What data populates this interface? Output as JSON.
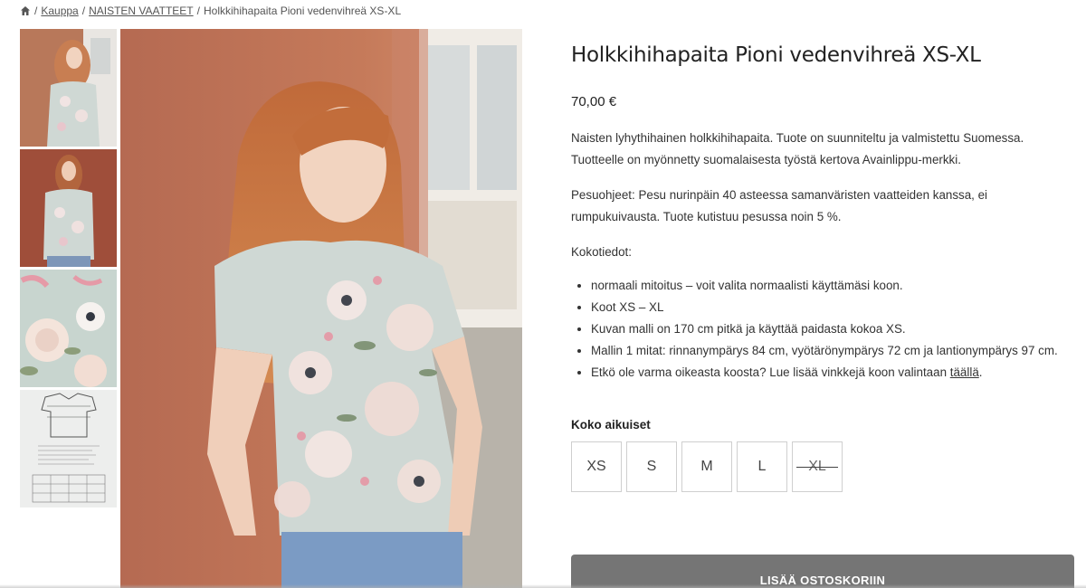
{
  "breadcrumb": {
    "icon": "home-icon",
    "items": [
      "Kauppa",
      "NAISTEN VAATTEET",
      "Holkkihihapaita Pioni vedenvihreä XS-XL"
    ]
  },
  "gallery": {
    "thumbnails": [
      {
        "alt": "Holkkihihapaita Pioni vedenvihreä XS-XL"
      },
      {
        "alt": "Holkkihihapaita Pioni vedenvihreä XS-XL"
      },
      {
        "alt": "Pioni kuosi"
      },
      {
        "alt": "Kokotaulukko"
      }
    ],
    "main_alt": "Holkkihihapaita Pioni vedenvihreä XS-XL"
  },
  "product": {
    "title": "Holkkihihapaita Pioni vedenvihreä XS-XL",
    "price": "70,00 €",
    "description_1": "Naisten lyhythihainen holkkihihapaita. Tuote on suunniteltu ja valmistettu Suomessa. Tuotteelle on myönnetty suomalaisesta työstä kertova Avainlippu-merkki.",
    "description_2": "Pesuohjeet: Pesu nurinpäin 40 asteessa samanväristen vaatteiden kanssa, ei rumpukuivausta. Tuote kutistuu pesussa noin 5 %.",
    "size_info_heading": "Kokotiedot:",
    "bullets": [
      "normaali mitoitus – voit valita normaalisti käyttämäsi koon.",
      "Koot XS – XL",
      "Kuvan malli  on 170 cm pitkä ja käyttää paidasta kokoa XS.",
      "Mallin 1 mitat: rinnanympärys 84 cm, vyötärönympärys 72 cm ja lantionympärys 97 cm."
    ],
    "last_bullet_text": "Etkö ole varma oikeasta koosta? Lue lisää vinkkejä koon valintaan ",
    "last_bullet_link": "täällä",
    "last_bullet_end": "."
  },
  "size_selector": {
    "label": "Koko aikuiset",
    "options": [
      {
        "label": "XS",
        "available": true
      },
      {
        "label": "S",
        "available": true
      },
      {
        "label": "M",
        "available": true
      },
      {
        "label": "L",
        "available": true
      },
      {
        "label": "XL",
        "available": false
      }
    ]
  },
  "cart": {
    "button_label": "LISÄÄ OSTOSKORIIN",
    "button_color": "#757575"
  }
}
